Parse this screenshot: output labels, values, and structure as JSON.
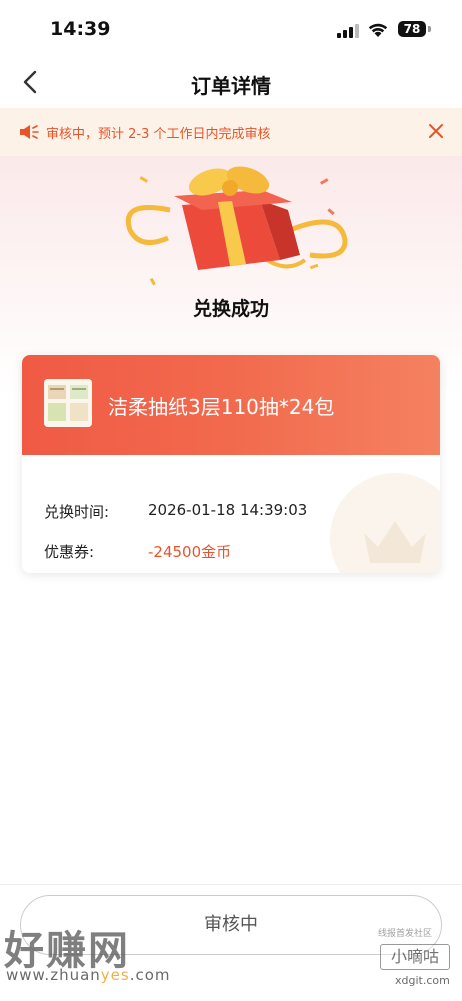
{
  "status_bar": {
    "time": "14:39",
    "battery": "78"
  },
  "nav": {
    "title": "订单详情"
  },
  "notice": {
    "text": "审核中，预计 2-3 个工作日内完成审核"
  },
  "hero": {
    "title": "兑换成功"
  },
  "order": {
    "product_name": "洁柔抽纸3层110抽*24包",
    "redeem_time_label": "兑换时间:",
    "redeem_time": "2026-01-18 14:39:03",
    "coupon_label": "优惠券:",
    "coupon_value": "-24500金币"
  },
  "bottom": {
    "status_label": "审核中"
  },
  "watermarks": {
    "left_main": "好赚网",
    "left_sub_a": "www.zhuan",
    "left_sub_b": "yes",
    "left_sub_c": ".com",
    "right_small": "线报首发社区",
    "right_main": "小嘀咕",
    "right_url": "xdgit.com"
  },
  "colors": {
    "accent": "#e8542a",
    "card_header": "#f26a4e",
    "notice_bg": "#fdf2e7"
  }
}
